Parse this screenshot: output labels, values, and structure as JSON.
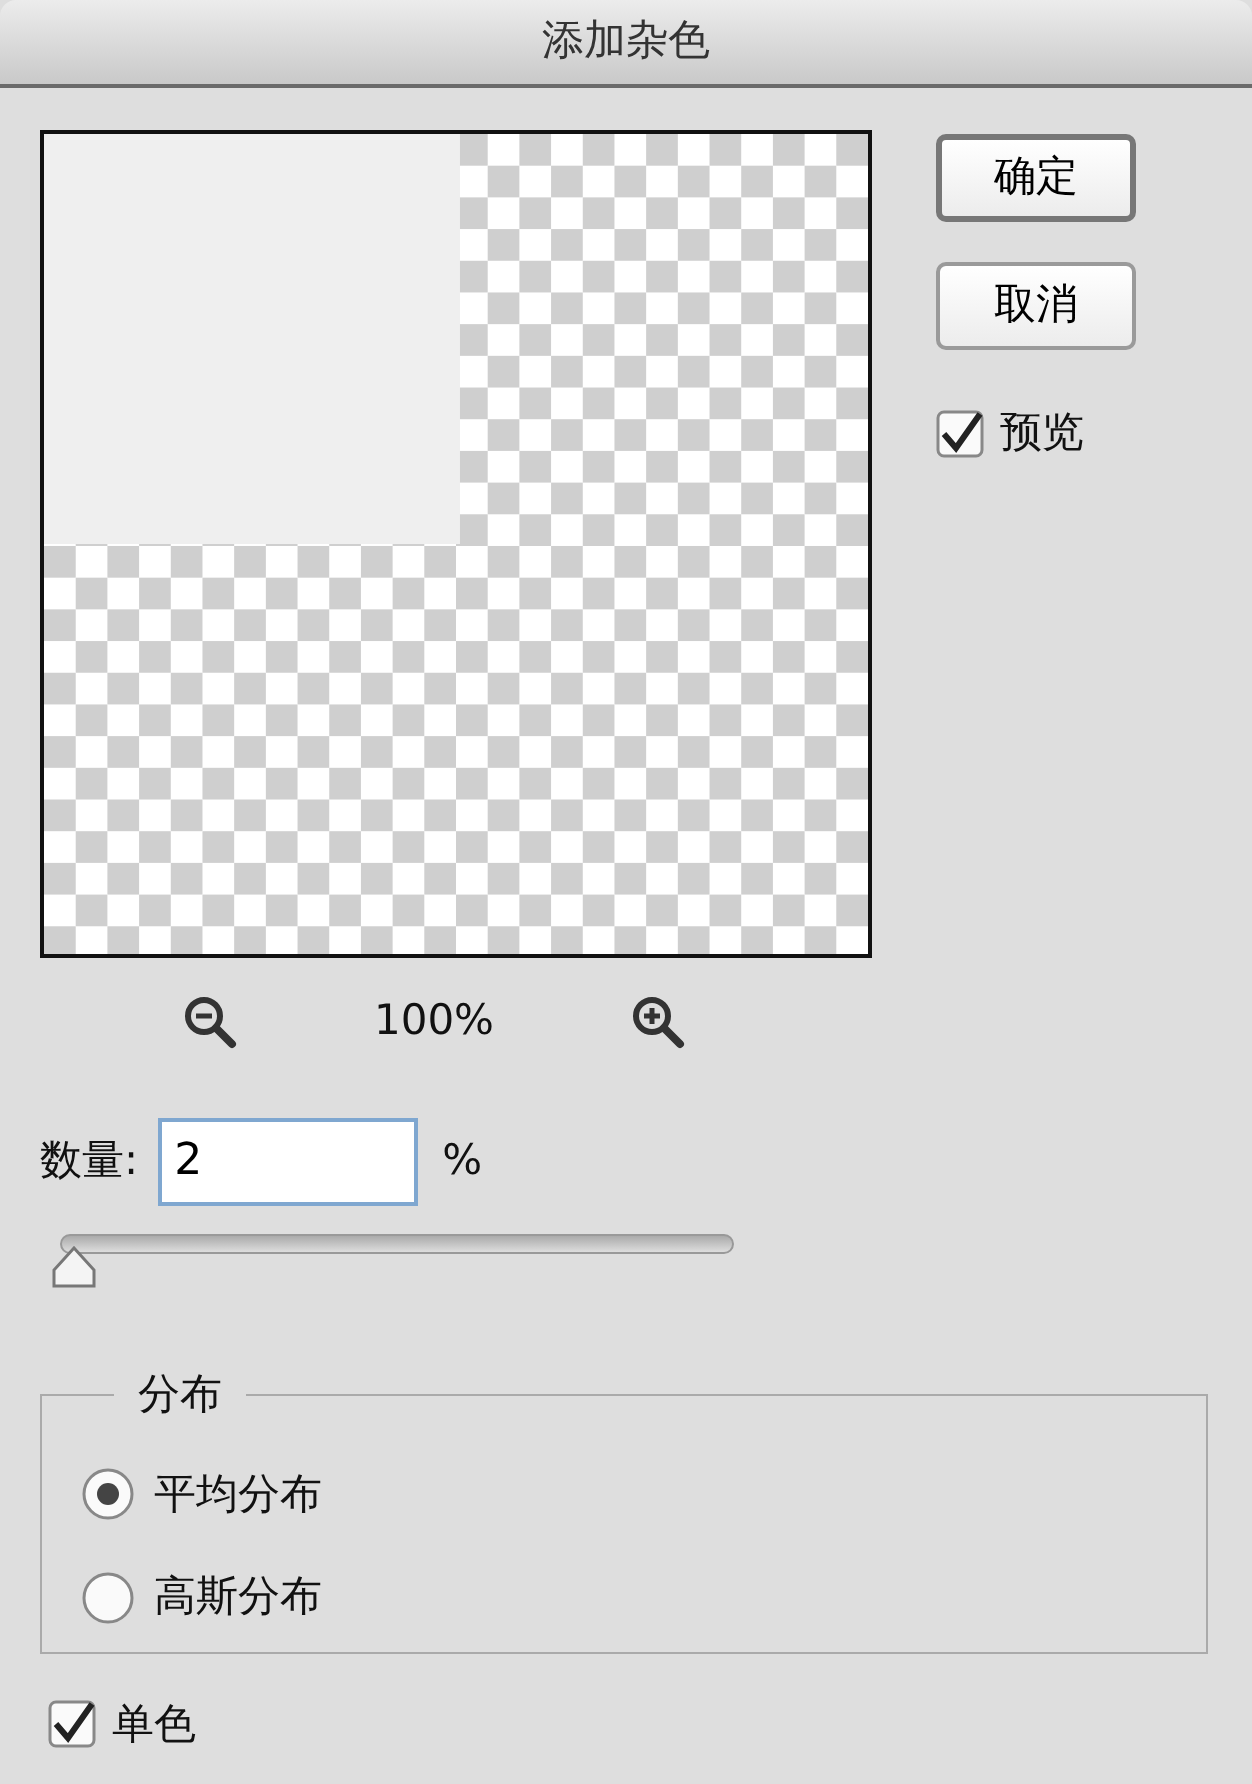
{
  "window": {
    "title": "添加杂色"
  },
  "preview": {
    "zoom": "100%"
  },
  "buttons": [
    {
      "label": "确定",
      "default": true
    },
    {
      "label": "取消",
      "default": false
    }
  ],
  "preview_toggle": {
    "label": "预览",
    "checked": true
  },
  "amount": {
    "label": "数量:",
    "value": "2",
    "unit": "%",
    "level": 0.02
  },
  "distribution": {
    "title": "分布",
    "options": [
      {
        "label": "平均分布",
        "selected": true
      },
      {
        "label": "高斯分布",
        "selected": false
      }
    ]
  },
  "monochrome": {
    "label": "单色",
    "checked": true
  }
}
